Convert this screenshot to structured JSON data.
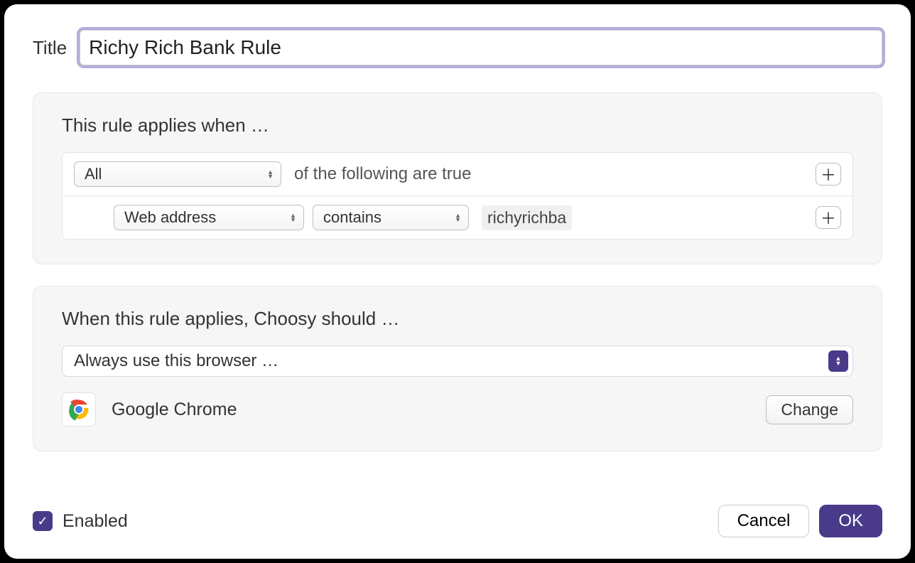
{
  "title": {
    "label": "Title",
    "value": "Richy Rich Bank Rule"
  },
  "rule_section": {
    "heading": "This rule applies when …",
    "quantifier": "All",
    "quantifier_suffix": "of the following are true",
    "conditions": [
      {
        "field": "Web address",
        "operator": "contains",
        "value": "richyrichba"
      }
    ]
  },
  "action_section": {
    "heading": "When this rule applies, Choosy should …",
    "action": "Always use this browser …",
    "browser": "Google Chrome",
    "change_label": "Change"
  },
  "footer": {
    "enabled_label": "Enabled",
    "enabled_checked": true,
    "cancel": "Cancel",
    "ok": "OK"
  }
}
